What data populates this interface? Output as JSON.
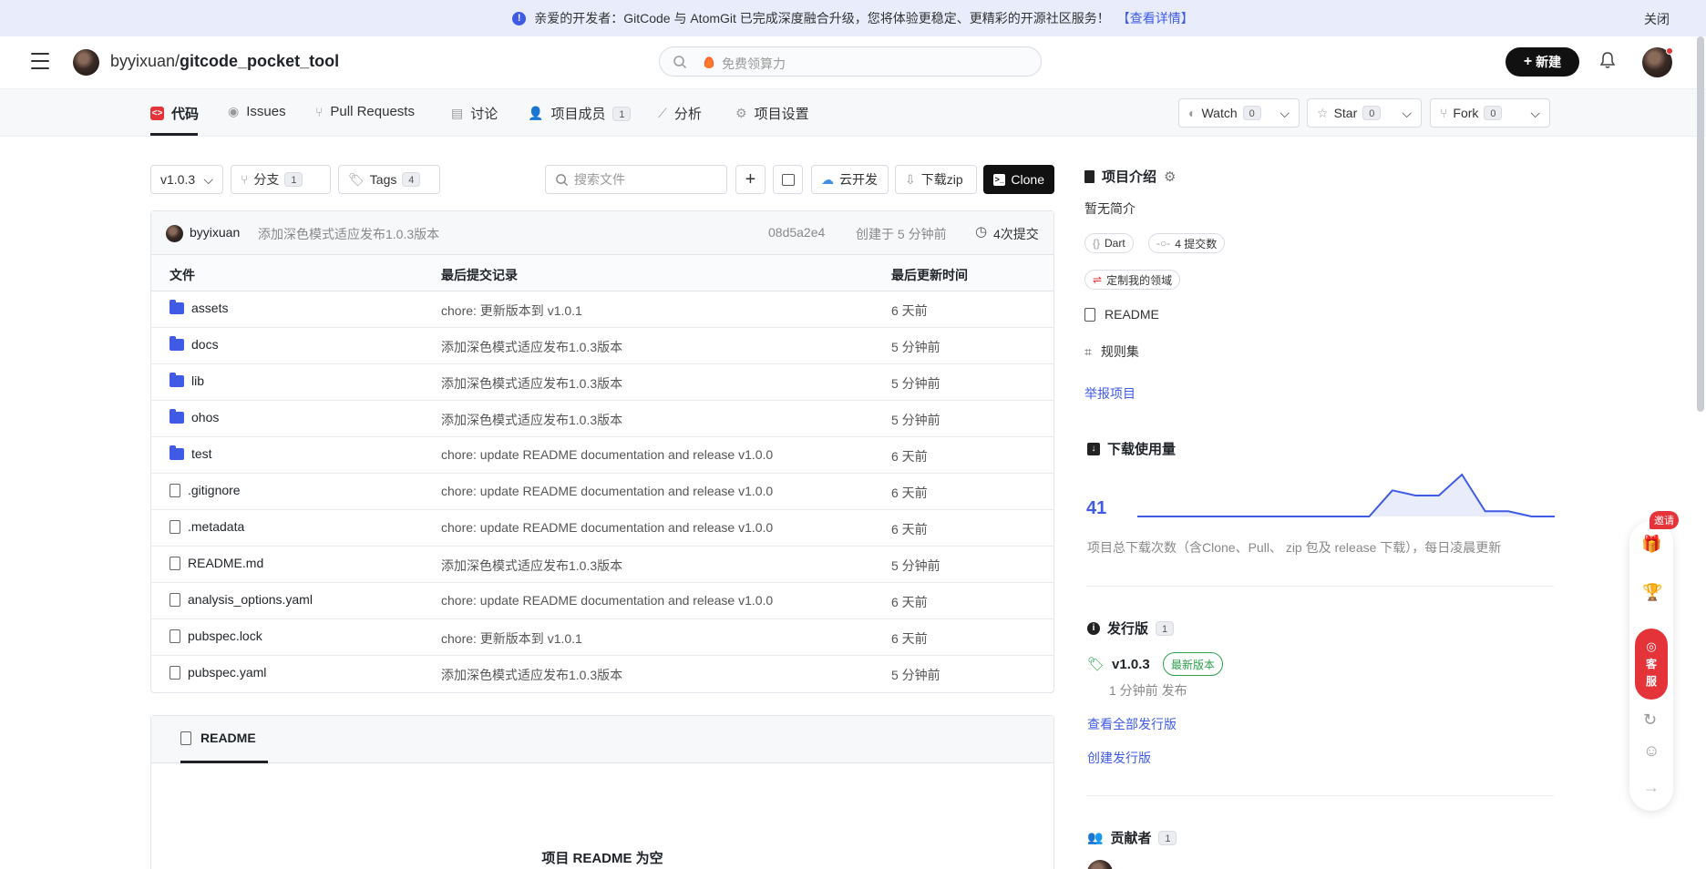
{
  "banner": {
    "text": "亲爱的开发者：GitCode 与 AtomGit 已完成深度融合升级，您将体验更稳定、更精彩的开源社区服务！",
    "link": "【查看详情】",
    "close": "关闭"
  },
  "header": {
    "owner": "byyixuan/",
    "repo": "gitcode_pocket_tool",
    "search_placeholder": "免费领算力",
    "new_label": "新建"
  },
  "tabs": [
    {
      "label": "代码"
    },
    {
      "label": "Issues"
    },
    {
      "label": "Pull Requests"
    },
    {
      "label": "讨论"
    },
    {
      "label": "项目成员",
      "count": "1"
    },
    {
      "label": "分析"
    },
    {
      "label": "项目设置"
    }
  ],
  "watch": {
    "label": "Watch",
    "count": "0"
  },
  "star": {
    "label": "Star",
    "count": "0"
  },
  "fork": {
    "label": "Fork",
    "count": "0"
  },
  "toolbar": {
    "branch": "v1.0.3",
    "branches_label": "分支",
    "branches_count": "1",
    "tags_label": "Tags",
    "tags_count": "4",
    "search_placeholder": "搜索文件",
    "cloud_dev": "云开发",
    "download_zip": "下载zip",
    "clone": "Clone"
  },
  "commit": {
    "author": "byyixuan",
    "message": "添加深色模式适应发布1.0.3版本",
    "sha": "08d5a2e4",
    "created": "创建于 5 分钟前",
    "commits": "4次提交"
  },
  "table": {
    "headers": [
      "文件",
      "最后提交记录",
      "最后更新时间"
    ],
    "rows": [
      {
        "name": "assets",
        "type": "folder",
        "msg": "chore: 更新版本到 v1.0.1",
        "time": "6 天前"
      },
      {
        "name": "docs",
        "type": "folder",
        "msg": "添加深色模式适应发布1.0.3版本",
        "time": "5 分钟前"
      },
      {
        "name": "lib",
        "type": "folder",
        "msg": "添加深色模式适应发布1.0.3版本",
        "time": "5 分钟前"
      },
      {
        "name": "ohos",
        "type": "folder",
        "msg": "添加深色模式适应发布1.0.3版本",
        "time": "5 分钟前"
      },
      {
        "name": "test",
        "type": "folder",
        "msg": "chore: update README documentation and release v1.0.0",
        "time": "6 天前"
      },
      {
        "name": ".gitignore",
        "type": "file",
        "msg": "chore: update README documentation and release v1.0.0",
        "time": "6 天前"
      },
      {
        "name": ".metadata",
        "type": "file",
        "msg": "chore: update README documentation and release v1.0.0",
        "time": "6 天前"
      },
      {
        "name": "README.md",
        "type": "file",
        "msg": "添加深色模式适应发布1.0.3版本",
        "time": "5 分钟前"
      },
      {
        "name": "analysis_options.yaml",
        "type": "file",
        "msg": "chore: update README documentation and release v1.0.0",
        "time": "6 天前"
      },
      {
        "name": "pubspec.lock",
        "type": "file",
        "msg": "chore: 更新版本到 v1.0.1",
        "time": "6 天前"
      },
      {
        "name": "pubspec.yaml",
        "type": "file",
        "msg": "添加深色模式适应发布1.0.3版本",
        "time": "5 分钟前"
      }
    ]
  },
  "readme": {
    "tab": "README",
    "empty": "项目 README 为空"
  },
  "sidebar": {
    "intro_title": "项目介绍",
    "intro_text": "暂无简介",
    "lang": "Dart",
    "commits": "4 提交数",
    "custom_domain": "定制我的领域",
    "readme": "README",
    "rules": "规则集",
    "report": "举报项目",
    "downloads_title": "下载使用量",
    "downloads_count": "41",
    "downloads_note": "项目总下载次数（含Clone、Pull、 zip 包及 release 下载），每日凌晨更新",
    "downloads_trend": [
      0,
      0,
      0,
      0,
      0,
      0,
      0,
      0,
      0,
      0,
      0,
      10,
      8,
      8,
      16,
      2,
      2,
      0,
      0
    ],
    "releases_title": "发行版",
    "releases_count": "1",
    "release_tag": "v1.0.3",
    "release_badge": "最新版本",
    "release_time": "1 分钟前 发布",
    "view_all": "查看全部发行版",
    "create_release": "创建发行版",
    "contributors_title": "贡献者",
    "contributors_count": "1"
  },
  "floating": {
    "invite": "邀请",
    "kefu_1": "客",
    "kefu_2": "服"
  },
  "colors": {
    "accent": "#3f5be6",
    "banner_bg": "#e8ecfb",
    "dark_btn": "#111111",
    "green": "#2ea04d",
    "red": "#e5333a"
  }
}
